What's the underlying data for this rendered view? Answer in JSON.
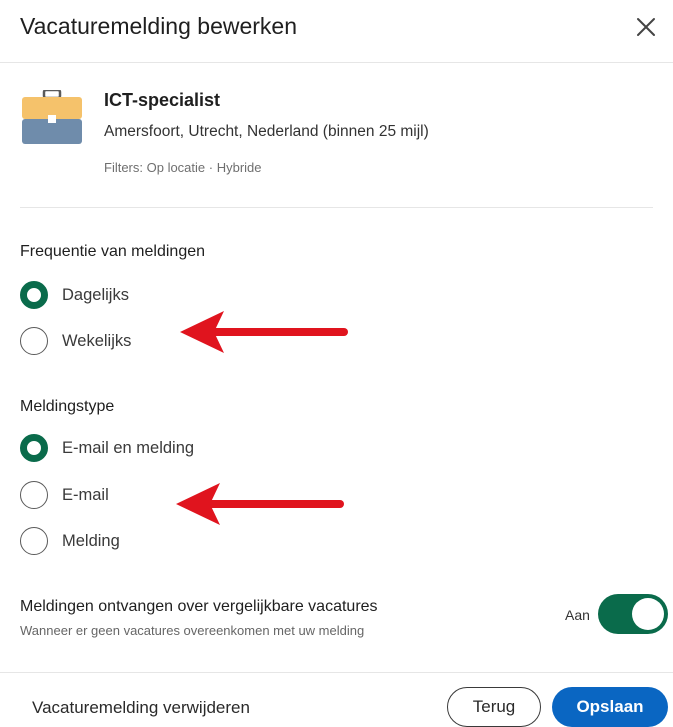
{
  "dialog": {
    "title": "Vacaturemelding bewerken",
    "close_icon": "close-icon"
  },
  "job": {
    "icon": "briefcase-icon",
    "title": "ICT-specialist",
    "location": "Amersfoort, Utrecht, Nederland (binnen 25 mijl)",
    "filters": "Filters: Op locatie · Hybride"
  },
  "frequency": {
    "title": "Frequentie van meldingen",
    "options": [
      {
        "label": "Dagelijks",
        "selected": true
      },
      {
        "label": "Wekelijks",
        "selected": false
      }
    ]
  },
  "notification_type": {
    "title": "Meldingstype",
    "options": [
      {
        "label": "E-mail en melding",
        "selected": true
      },
      {
        "label": "E-mail",
        "selected": false
      },
      {
        "label": "Melding",
        "selected": false
      }
    ]
  },
  "similar": {
    "title": "Meldingen ontvangen over vergelijkbare vacatures",
    "subtitle": "Wanneer er geen vacatures overeenkomen met uw melding",
    "toggle_label": "Aan",
    "toggle_on": true
  },
  "footer": {
    "delete_label": "Vacaturemelding verwijderen",
    "back_label": "Terug",
    "save_label": "Opslaan"
  },
  "colors": {
    "accent_green": "#0a6b4b",
    "primary_blue": "#0a66c2",
    "annotation_red": "#e0141e",
    "briefcase_top": "#f5c26b",
    "briefcase_bottom": "#6f8cab"
  }
}
